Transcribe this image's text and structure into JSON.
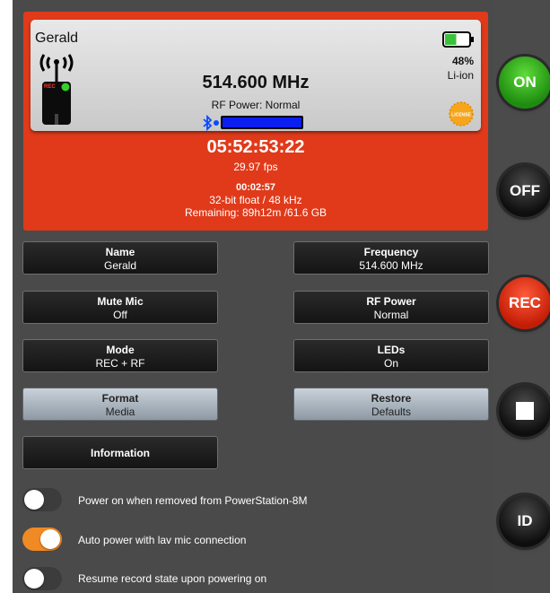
{
  "device": {
    "name": "Gerald",
    "frequency": "514.600 MHz",
    "rf_power_status": "RF Power: Normal",
    "rec_badge": "REC",
    "battery_percent": "48%",
    "battery_level": 0.48,
    "battery_type": "Li-ion",
    "license_badge": "LICENSE"
  },
  "recording": {
    "timecode": "05:52:53:22",
    "fps": "29.97 fps",
    "duration": "00:02:57",
    "format": "32-bit float / 48 kHz",
    "remaining": "Remaining: 89h12m /61.6 GB"
  },
  "settings": {
    "name": {
      "label": "Name",
      "value": "Gerald"
    },
    "frequency": {
      "label": "Frequency",
      "value": "514.600 MHz"
    },
    "mute_mic": {
      "label": "Mute Mic",
      "value": "Off"
    },
    "rf_power": {
      "label": "RF Power",
      "value": "Normal"
    },
    "mode": {
      "label": "Mode",
      "value": "REC + RF"
    },
    "leds": {
      "label": "LEDs",
      "value": "On"
    },
    "format_media": {
      "label": "Format",
      "value": "Media"
    },
    "restore_defaults": {
      "label": "Restore",
      "value": "Defaults"
    },
    "information": {
      "label": "Information"
    }
  },
  "toggles": [
    {
      "label": "Power on when removed from PowerStation-8M",
      "on": false
    },
    {
      "label": "Auto power with lav mic connection",
      "on": true
    },
    {
      "label": "Resume record state upon powering on",
      "on": false
    }
  ],
  "controls": {
    "on": "ON",
    "off": "OFF",
    "rec": "REC",
    "id": "ID"
  },
  "colors": {
    "panel": "#e03a1a",
    "toggle_on": "#f08a24",
    "on_button": "#2fb41a",
    "rec_button": "#e8340f",
    "rf_bar": "#0a1ef0"
  }
}
